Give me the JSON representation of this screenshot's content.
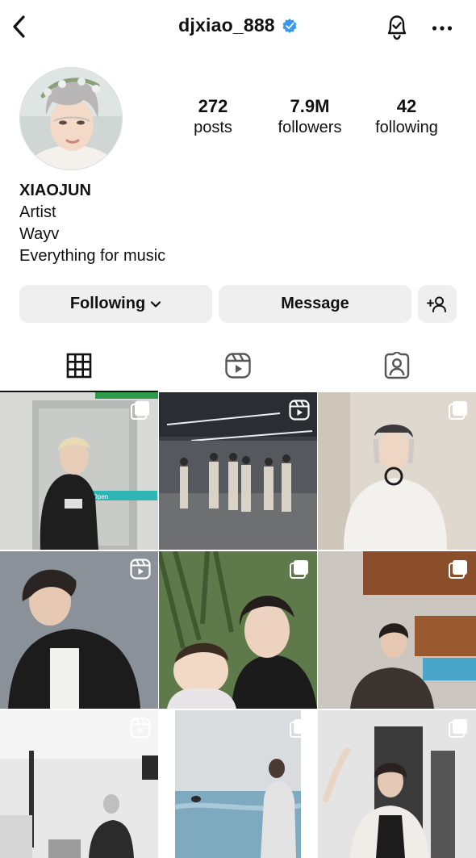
{
  "header": {
    "username": "djxiao_888"
  },
  "profile": {
    "stats": [
      {
        "number": "272",
        "label": "posts"
      },
      {
        "number": "7.9M",
        "label": "followers"
      },
      {
        "number": "42",
        "label": "following"
      }
    ],
    "name": "XIAOJUN",
    "bio_lines": [
      "Artist",
      "Wayv",
      "Everything for music"
    ]
  },
  "actions": {
    "following_label": "Following",
    "message_label": "Message"
  },
  "grid_posts": [
    {
      "type": "multi",
      "scene_text": "To Open"
    },
    {
      "type": "reel"
    },
    {
      "type": "multi"
    },
    {
      "type": "reel"
    },
    {
      "type": "multi"
    },
    {
      "type": "multi"
    },
    {
      "type": "reel"
    },
    {
      "type": "multi"
    },
    {
      "type": "multi"
    }
  ],
  "colors": {
    "verified": "#3897f0",
    "button_bg": "#efefef"
  }
}
